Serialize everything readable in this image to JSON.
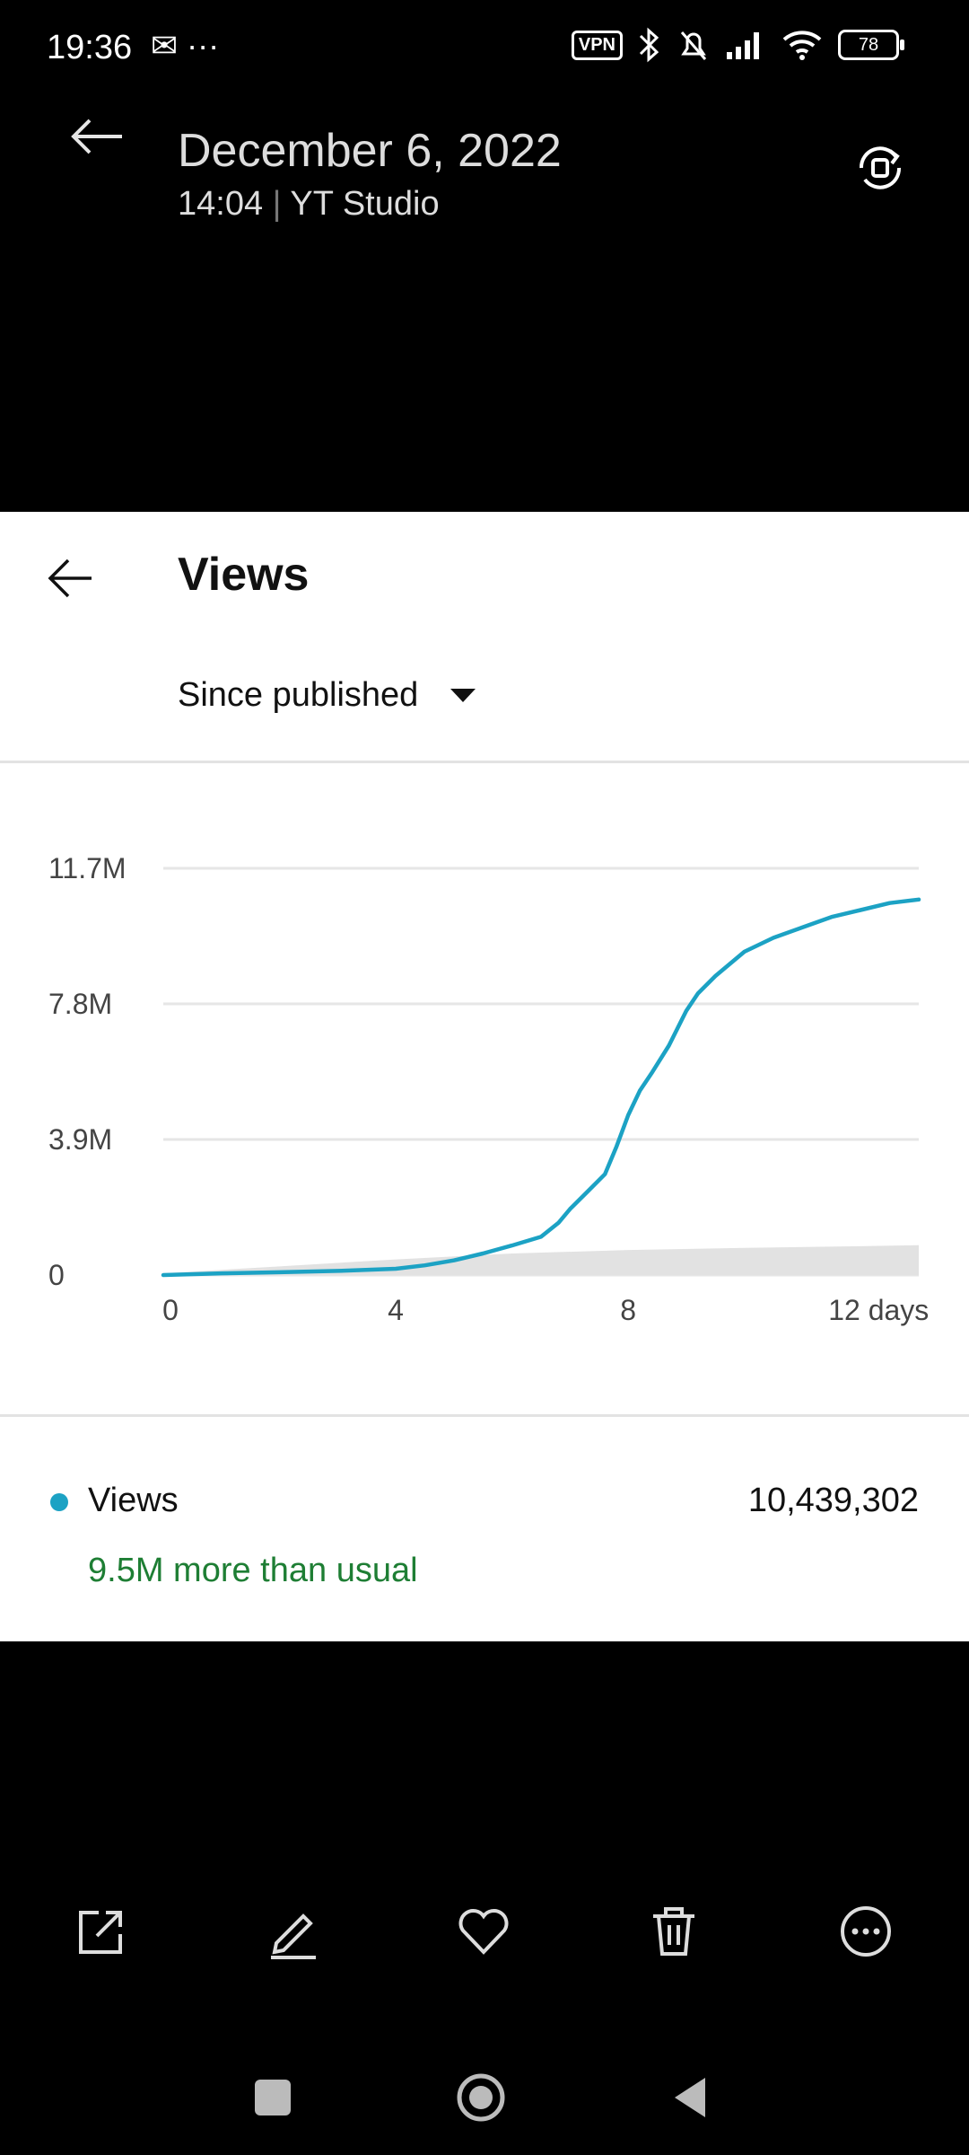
{
  "status_bar": {
    "time": "19:36",
    "extra": "✉ ···",
    "vpn": "VPN",
    "battery": "78"
  },
  "gallery": {
    "date_title": "December 6, 2022",
    "subtitle_time": "14:04",
    "subtitle_app": "YT Studio"
  },
  "yt": {
    "title": "Views",
    "range_label": "Since published",
    "legend_label": "Views",
    "legend_value": "10,439,302",
    "legend_note": "9.5M more than usual",
    "accent": "#1ca2c4",
    "note_color": "#1e7e34"
  },
  "chart_data": {
    "type": "line",
    "title": "",
    "xlabel": "",
    "ylabel": "",
    "y_ticks": [
      "0",
      "3.9M",
      "7.8M",
      "11.7M"
    ],
    "y_tick_values": [
      0,
      3.9,
      7.8,
      11.7
    ],
    "x_ticks": [
      "0",
      "4",
      "8",
      "12 days"
    ],
    "x_tick_values": [
      0,
      4,
      8,
      12
    ],
    "xlim": [
      0,
      13
    ],
    "ylim": [
      0,
      11.7
    ],
    "grid": true,
    "series": [
      {
        "name": "Views",
        "color": "#1ca2c4",
        "x": [
          0,
          1,
          2,
          3,
          4,
          4.5,
          5,
          5.5,
          6,
          6.5,
          6.8,
          7,
          7.3,
          7.6,
          7.8,
          8,
          8.2,
          8.4,
          8.7,
          9,
          9.2,
          9.5,
          10,
          10.5,
          11,
          11.5,
          12,
          12.5,
          13
        ],
        "y": [
          0.0,
          0.05,
          0.08,
          0.12,
          0.18,
          0.28,
          0.42,
          0.62,
          0.85,
          1.1,
          1.5,
          1.9,
          2.4,
          2.9,
          3.7,
          4.6,
          5.3,
          5.8,
          6.6,
          7.6,
          8.1,
          8.6,
          9.3,
          9.7,
          10.0,
          10.3,
          10.5,
          10.7,
          10.8
        ]
      }
    ],
    "baseline_band": {
      "x": [
        0,
        2,
        4,
        6,
        8,
        10,
        12,
        13
      ],
      "low": [
        0,
        0,
        0,
        0,
        0,
        0,
        0,
        0
      ],
      "high": [
        0.05,
        0.25,
        0.45,
        0.62,
        0.72,
        0.78,
        0.83,
        0.86
      ],
      "color": "#e2e2e2"
    }
  }
}
